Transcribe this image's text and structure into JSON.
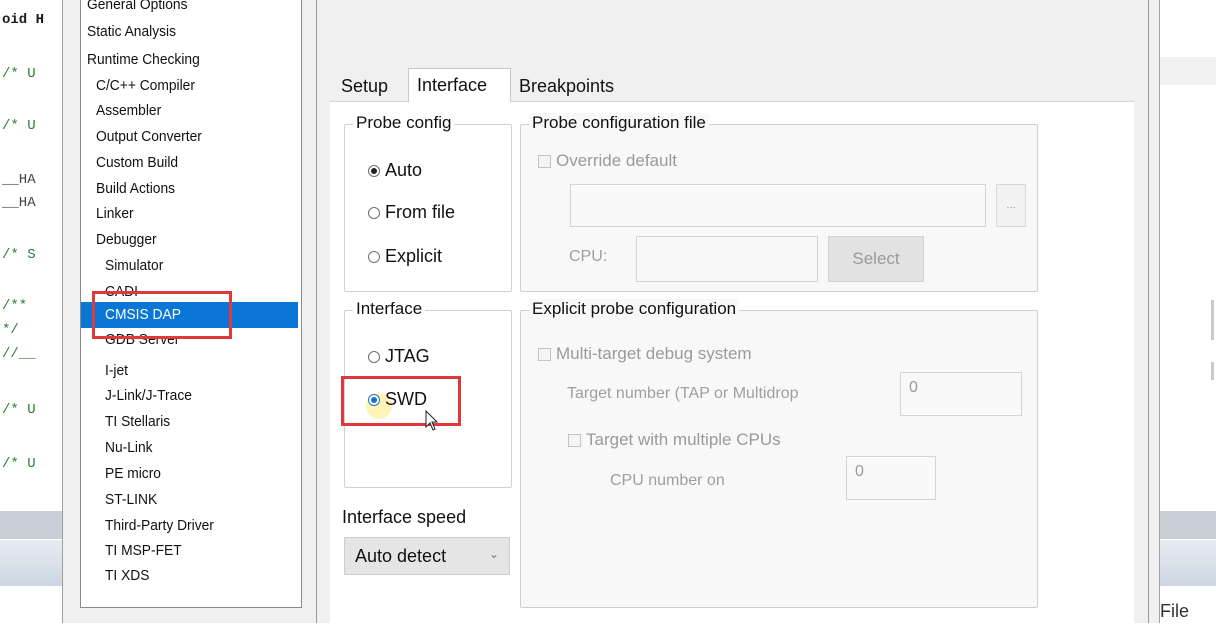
{
  "editor": {
    "lines": [
      {
        "text": "oid H",
        "style": "bold"
      },
      {
        "text": "/* U",
        "style": "comment"
      },
      {
        "text": "/* U",
        "style": "comment"
      },
      {
        "text": "__HA",
        "style": "plain"
      },
      {
        "text": "__HA",
        "style": "plain"
      },
      {
        "text": "/* S",
        "style": "comment"
      },
      {
        "text": "/**",
        "style": "comment"
      },
      {
        "text": "*/",
        "style": "comment"
      },
      {
        "text": "//__",
        "style": "comment"
      },
      {
        "text": "/* U",
        "style": "comment"
      },
      {
        "text": "/* U",
        "style": "comment"
      }
    ],
    "file_label": "File"
  },
  "categories": [
    {
      "label": "General Options"
    },
    {
      "label": "Static Analysis"
    },
    {
      "label": "Runtime Checking"
    },
    {
      "label": "C/C++ Compiler"
    },
    {
      "label": "Assembler"
    },
    {
      "label": "Output Converter"
    },
    {
      "label": "Custom Build"
    },
    {
      "label": "Build Actions"
    },
    {
      "label": "Linker"
    },
    {
      "label": "Debugger"
    },
    {
      "label": "Simulator"
    },
    {
      "label": "CADI"
    },
    {
      "label": "CMSIS DAP",
      "selected": true
    },
    {
      "label": "GDB Server"
    },
    {
      "label": "I-jet"
    },
    {
      "label": "J-Link/J-Trace"
    },
    {
      "label": "TI Stellaris"
    },
    {
      "label": "Nu-Link"
    },
    {
      "label": "PE micro"
    },
    {
      "label": "ST-LINK"
    },
    {
      "label": "Third-Party Driver"
    },
    {
      "label": "TI MSP-FET"
    },
    {
      "label": "TI XDS"
    }
  ],
  "tabs": {
    "setup": "Setup",
    "interface": "Interface",
    "breakpoints": "Breakpoints",
    "active": "Interface"
  },
  "probe_config": {
    "title": "Probe config",
    "options": [
      "Auto",
      "From file",
      "Explicit"
    ],
    "selected": "Auto"
  },
  "probe_file": {
    "title": "Probe configuration file",
    "override_label": "Override default",
    "override_checked": false,
    "path_value": "",
    "browse_label": "...",
    "cpu_label": "CPU:",
    "cpu_value": "",
    "select_button": "Select"
  },
  "interface": {
    "title": "Interface",
    "options": [
      "JTAG",
      "SWD"
    ],
    "selected": "SWD"
  },
  "explicit": {
    "title": "Explicit probe configuration",
    "multi_target_label": "Multi-target debug system",
    "target_number_label": "Target number (TAP or Multidrop",
    "target_number_value": "0",
    "multi_cpu_label": "Target with multiple CPUs",
    "cpu_number_label": "CPU number on",
    "cpu_number_value": "0"
  },
  "interface_speed": {
    "label": "Interface speed",
    "value": "Auto detect"
  },
  "colors": {
    "selection": "#0a76d6",
    "highlight_box": "#e0393b",
    "radio_accent": "#1a72c9"
  }
}
